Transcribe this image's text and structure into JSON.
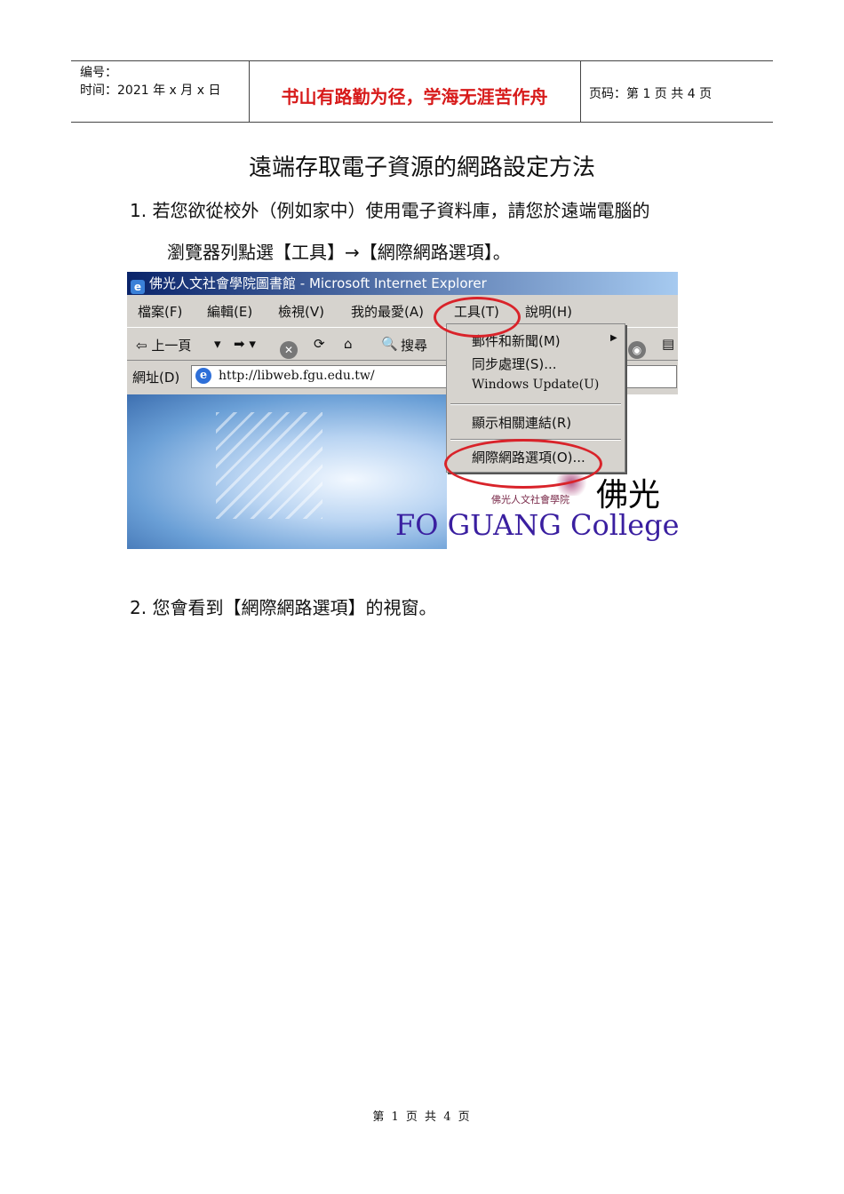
{
  "header": {
    "serial_label": "编号：",
    "date_label": "时间：2021 年 x 月 x 日",
    "motto": "书山有路勤为径，学海无涯苦作舟",
    "page_info": "页码：第 1 页  共 4 页"
  },
  "doc": {
    "title": "遠端存取電子資源的網路設定方法",
    "step1_line1": "1. 若您欲從校外（例如家中）使用電子資料庫，請您於遠端電腦的",
    "step1_line2": "瀏覽器列點選【工具】→【網際網路選項】。",
    "step2": "2. 您會看到【網際網路選項】的視窗。"
  },
  "screenshot": {
    "window_title": "佛光人文社會學院圖書館 - Microsoft Internet Explorer",
    "menu": [
      "檔案(F)",
      "編輯(E)",
      "檢視(V)",
      "我的最愛(A)",
      "工具(T)",
      "說明(H)"
    ],
    "toolbar": {
      "back": "⇦ 上一頁",
      "search": "搜尋"
    },
    "address_label": "網址(D)",
    "address_url": "http://libweb.fgu.edu.tw/",
    "tools_menu_items": [
      "郵件和新聞(M)",
      "同步處理(S)...",
      "Windows Update(U)",
      "顯示相關連結(R)",
      "網際網路選項(O)..."
    ],
    "logo_cn": "佛光",
    "logo_sub": "佛光人文社會學院",
    "logo_en": "FO GUANG College o",
    "highlight_color": "#d9232a"
  },
  "footer": {
    "page": "第 1 页 共 4 页"
  }
}
